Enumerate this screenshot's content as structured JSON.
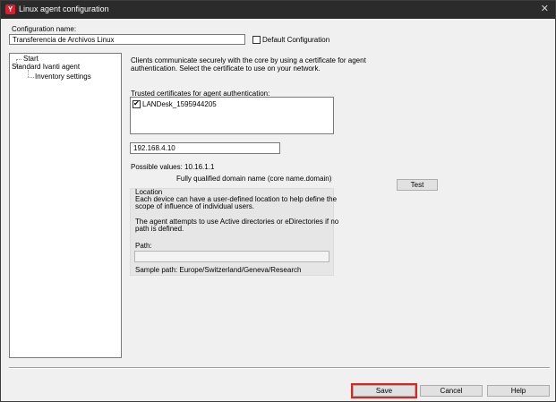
{
  "window": {
    "title": "Linux agent configuration",
    "close_symbol": "✕"
  },
  "config": {
    "name_label": "Configuration name:",
    "name_value": "Transferencia de Archivos Linux",
    "default_label": "Default Configuration",
    "default_checked": false
  },
  "tree": {
    "items": [
      {
        "label": "Start"
      },
      {
        "label": "Standard Ivanti agent"
      },
      {
        "label": "Inventory settings"
      }
    ]
  },
  "main": {
    "description": [
      "Clients communicate securely with the core by using a certificate for agent",
      "authentication. Select the certificate to use on your network."
    ],
    "trusted_label": "Trusted certificates for agent authentication:",
    "certificates": [
      {
        "name": "LANDesk_1595944205",
        "checked": true
      }
    ],
    "core_address": "192.168.4.10",
    "possible_values": "Possible values: 10.16.1.1",
    "fqdn_hint": "Fully qualified domain name (core name.domain)",
    "test_label": "Test"
  },
  "location": {
    "title": "Location",
    "desc1": [
      "Each device can have a user-defined location to help define the",
      "scope of influence of individual users."
    ],
    "desc2": [
      "The agent attempts to use Active directories or eDirectories if no",
      "path is defined."
    ],
    "path_label": "Path:",
    "path_value": "",
    "sample": "Sample path: Europe/Switzerland/Geneva/Research"
  },
  "footer": {
    "save_label": "Save",
    "cancel_label": "Cancel",
    "help_label": "Help"
  },
  "colors": {
    "titlebar": "#2b2b2b",
    "highlight": "#e2231a",
    "app_icon": "#d6202f"
  }
}
